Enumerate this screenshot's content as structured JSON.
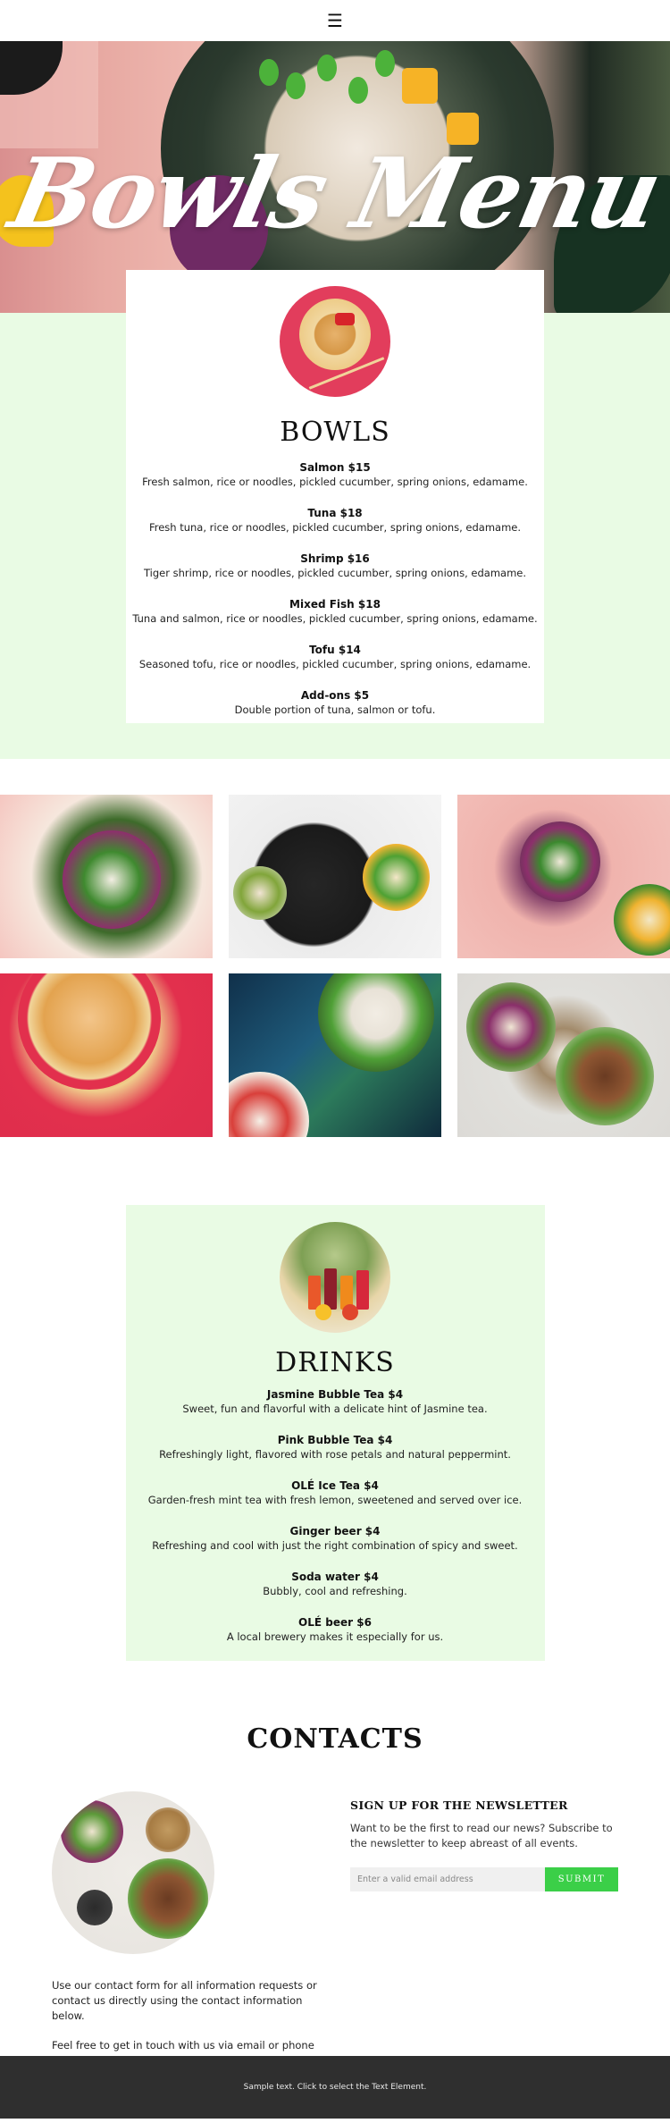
{
  "header": {
    "menu_icon": "hamburger-icon",
    "menu_glyph": "☰"
  },
  "hero": {
    "title": "Bowls Menu"
  },
  "bowls": {
    "title": "BOWLS",
    "items": [
      {
        "name": "Salmon $15",
        "desc": "Fresh salmon, rice or noodles, pickled cucumber, spring onions, edamame."
      },
      {
        "name": "Tuna $18",
        "desc": "Fresh tuna, rice or noodles, pickled cucumber, spring onions, edamame."
      },
      {
        "name": "Shrimp $16",
        "desc": "Tiger shrimp, rice or noodles, pickled cucumber, spring onions, edamame."
      },
      {
        "name": "Mixed Fish $18",
        "desc": "Tuna and salmon, rice or noodles, pickled cucumber, spring onions, edamame."
      },
      {
        "name": "Tofu $14",
        "desc": "Seasoned tofu, rice or noodles, pickled cucumber, spring onions, edamame."
      },
      {
        "name": "Add-ons $5",
        "desc": "Double portion of tuna, salmon or tofu."
      }
    ]
  },
  "drinks": {
    "title": "DRINKS",
    "items": [
      {
        "name": "Jasmine Bubble Tea $4",
        "desc": "Sweet, fun and flavorful with a delicate hint of Jasmine tea."
      },
      {
        "name": "Pink Bubble Tea $4",
        "desc": "Refreshingly light, flavored with rose petals and natural peppermint."
      },
      {
        "name": "OLÉ Ice Tea $4",
        "desc": "Garden-fresh mint tea with fresh lemon, sweetened and served over ice."
      },
      {
        "name": "Ginger beer $4",
        "desc": "Refreshing and cool with just the right combination of spicy and sweet."
      },
      {
        "name": "Soda water $4",
        "desc": "Bubbly, cool and refreshing."
      },
      {
        "name": "OLÉ beer $6",
        "desc": "A local brewery makes it especially for us."
      }
    ]
  },
  "contacts": {
    "title": "CONTACTS",
    "text1": "Use our contact form for all information requests or contact us directly using the contact information below.",
    "text2": "Feel free to get in touch with us via email or phone",
    "newsletter": {
      "title": "SIGN UP FOR THE NEWSLETTER",
      "text": "Want to be the first to read our news? Subscribe to the newsletter to keep abreast of all events.",
      "placeholder": "Enter a valid email address",
      "button": "SUBMIT"
    }
  },
  "footer": {
    "text": "Sample text. Click to select the Text Element."
  },
  "colors": {
    "accent_green": "#3bcf48",
    "mint_bg": "#e9fbe4",
    "footer_bg": "#2f2f2f"
  }
}
